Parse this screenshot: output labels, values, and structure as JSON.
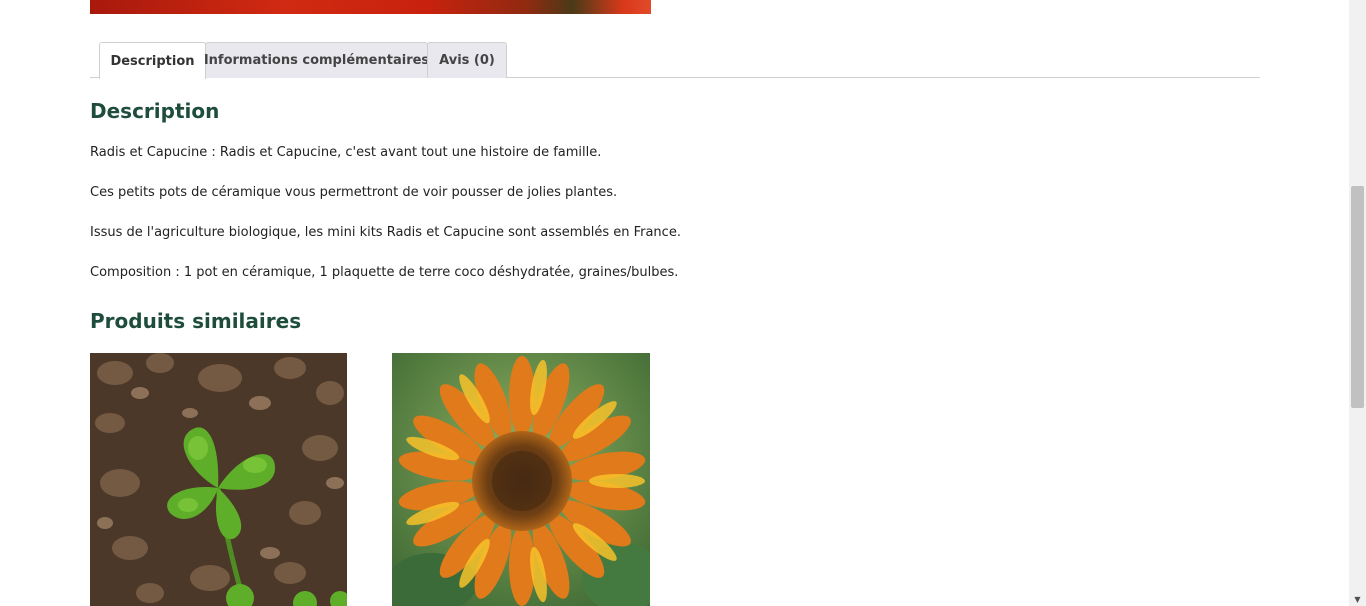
{
  "tabs": [
    {
      "label": "Description",
      "active": true
    },
    {
      "label": "Informations complémentaires",
      "active": false
    },
    {
      "label": "Avis (0)",
      "active": false
    }
  ],
  "description": {
    "title": "Description",
    "paragraphs": [
      "Radis et Capucine : Radis et Capucine, c'est avant tout une histoire de famille.",
      "Ces petits pots de céramique vous permettront de voir pousser de jolies plantes.",
      "Issus de l'agriculture biologique, les mini kits Radis et Capucine sont assemblés en France.",
      "Composition : 1 pot en céramique, 1 plaquette de terre coco déshydratée, graines/bulbes."
    ]
  },
  "related": {
    "title": "Produits similaires",
    "products": [
      {
        "image": "clover-on-gravel"
      },
      {
        "image": "sunflower"
      }
    ]
  },
  "colors": {
    "heading": "#1e4d3b",
    "tab_inactive_bg": "#e9e8ee",
    "text": "#222222"
  },
  "icons": {
    "scroll_down": "▼"
  }
}
